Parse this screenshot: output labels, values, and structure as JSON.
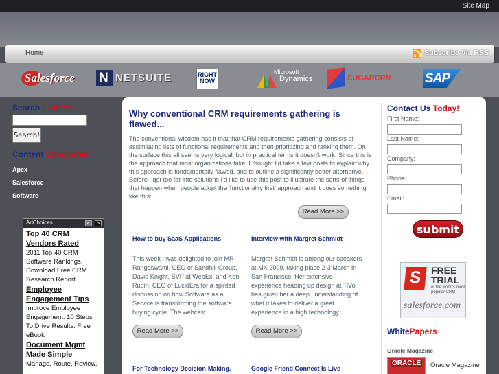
{
  "topbar": {
    "sitemap": "Site Map"
  },
  "nav": {
    "home": "Home",
    "rss": "Subscribe Via RSS"
  },
  "logos": {
    "salesforce": "Salesforce",
    "netsuite": "NETSUITE",
    "rightnow_1": "RIGHT",
    "rightnow_2": "NOW",
    "microsoft_1": "Microsoft",
    "microsoft_2": "Dynamics",
    "sugarcrm": "SUGARCRM",
    "sap": "SAP"
  },
  "left": {
    "search_heading_1": "Search",
    "search_heading_2": "Content",
    "search_button": "Search!",
    "categories_heading_1": "Content",
    "categories_heading_2": "Categories",
    "categories": [
      "Apex",
      "Salesforce",
      "Software"
    ]
  },
  "ad": {
    "label": "AdChoices",
    "prev": "<",
    "next": ">",
    "items": [
      {
        "title": "Top 40 CRM Vendors Rated",
        "text": "2011 Top 40 CRM Software Rankings. Download Free CRM Research Report."
      },
      {
        "title": "Employee Engagement Tips",
        "text": "Improve Employee Engagement: 10 Steps To Drive Results. Free eBook"
      },
      {
        "title": "Document Mgmt Made Simple",
        "text": "Manage, Route, Review,"
      }
    ]
  },
  "main": {
    "feature": {
      "title": "Why conventional CRM requirements gathering is flawed...",
      "body": "The conventional wisdom has it that that CRM requirements gathering consists of assimilating lists of functional requirements and then prioritizing and ranking them. On the surface this all seems very logical, but in practical terms it doesn't work. Since this is the approach that most organizations take, I thought I'd take a few posts to explain why this approach is fundamentally flawed, and to outline a significantly better alternative. Before I get too far into solutions I'd like to use this post to illustrate the sorts of things that happen when people adopt the 'functionality first' approach and it goes something like this:",
      "read_more": "Read More >>"
    },
    "posts": [
      {
        "title": "How to buy SaaS Applications",
        "body": "This week I was delighted to join MR Rangaswami, CEO of Sandhill Group, David Knight, SVP at WebEx, and Ken Rudin, CEO of LucidEra for a spirited discussion on how Software as a Service is transforming the software buying cycle. The webcast...",
        "read_more": "Read More >>"
      },
      {
        "title": "Interview with Margret Schmidt",
        "body": "Margret Schmidt is among our speakers at MX 2009, taking place 2-3 March in San Francisco. Her extensive experience heading up design at TiVo has given her a deep understanding of what it takes to deliver a great experience in a high technology...",
        "read_more": "Read More >>"
      },
      {
        "title": "For Technology Decision-Making,",
        "body": ""
      },
      {
        "title": "Google Friend Connect Is Live",
        "body": ""
      }
    ]
  },
  "right": {
    "contact_1": "Contact Us",
    "contact_2": "Today!",
    "fields": [
      "First Name:",
      "Last Name:",
      "Company:",
      "Phone:",
      "Email:"
    ],
    "submit": "submit",
    "trial": {
      "free": "FREE TRIAL",
      "sub": "of the world's most popular CRM.",
      "brand": "salesforce.com"
    },
    "whitepapers_1": "White",
    "whitepapers_2": "Papers",
    "oracle_heading": "Oracle Magazine",
    "oracle_logo": "ORACLE",
    "oracle_text": "Oracle Magazine"
  }
}
